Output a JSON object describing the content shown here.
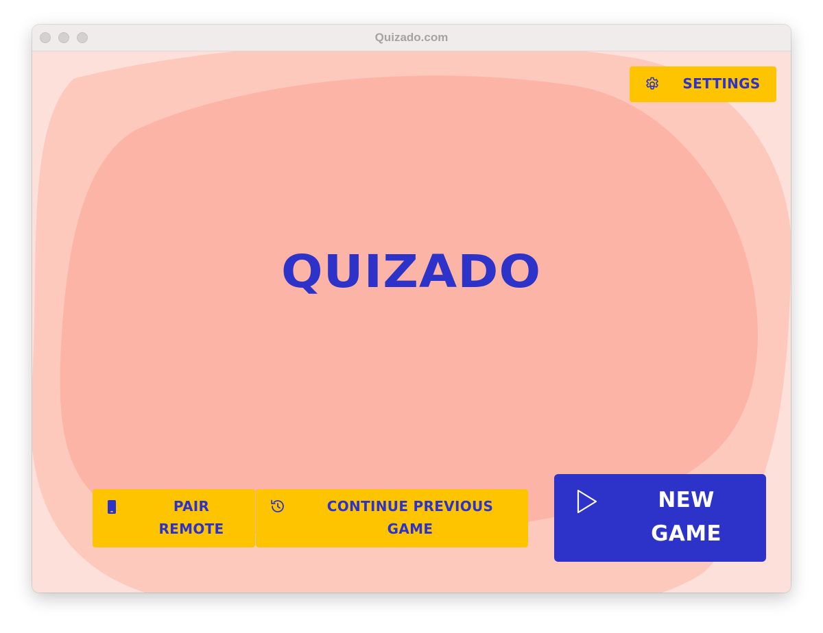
{
  "window": {
    "title": "Quizado.com"
  },
  "logo": {
    "text": "QUIZADO"
  },
  "settings_button": {
    "label": "SETTINGS",
    "icon": "gear-icon"
  },
  "pair_remote_button": {
    "label_line1": "PAIR",
    "label_line2": "REMOTE",
    "icon": "phone-icon"
  },
  "continue_button": {
    "label_line1": "CONTINUE PREVIOUS",
    "label_line2": "GAME",
    "icon": "history-icon"
  },
  "new_game_button": {
    "label_line1": "NEW",
    "label_line2": "GAME",
    "icon": "play-icon"
  },
  "colors": {
    "background_outer": "#fde0da",
    "blob_mid": "#fdc9bd",
    "blob_inner": "#fcb4a6",
    "accent_blue": "#2d33c9",
    "accent_yellow": "#fec400"
  }
}
